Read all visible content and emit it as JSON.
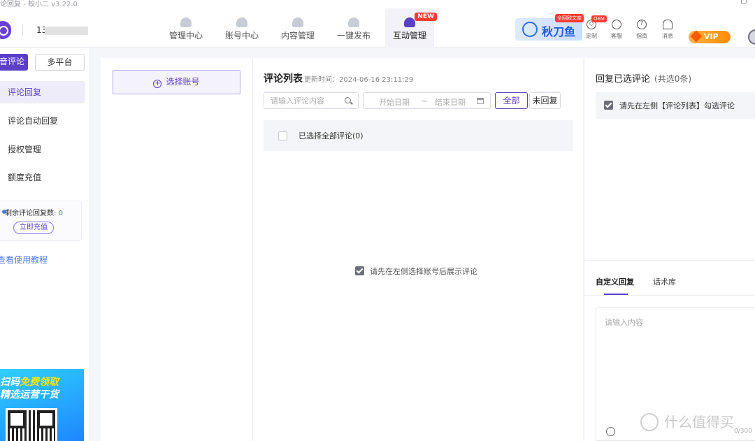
{
  "window": {
    "title": "论回复 - 蚁小二 v3.22.0"
  },
  "header": {
    "account_id": "13",
    "nav": [
      {
        "label": "管理中心",
        "icon": "dashboard-icon"
      },
      {
        "label": "账号中心",
        "icon": "user-icon"
      },
      {
        "label": "内容管理",
        "icon": "content-icon"
      },
      {
        "label": "一键发布",
        "icon": "publish-icon"
      },
      {
        "label": "互动管理",
        "icon": "robot-icon",
        "badge": "NEW",
        "active": true
      }
    ],
    "brand": {
      "name": "秋刀鱼",
      "badge": "全网欧文库"
    },
    "tools": [
      {
        "label": "定制",
        "icon": "diamond-icon",
        "badge": "OEM"
      },
      {
        "label": "客服",
        "icon": "headset-icon"
      },
      {
        "label": "指南",
        "icon": "help-icon"
      },
      {
        "label": "消息",
        "icon": "bell-icon"
      }
    ],
    "vip_label": "VIP"
  },
  "sidebar": {
    "tabs": [
      {
        "label": "音评论",
        "active": true
      },
      {
        "label": "多平台",
        "active": false
      }
    ],
    "menu": [
      {
        "label": "评论回复",
        "active": true
      },
      {
        "label": "评论自动回复"
      },
      {
        "label": "授权管理"
      },
      {
        "label": "额度充值"
      }
    ],
    "quota": {
      "label": "剩余评论回复数:",
      "value": "0",
      "button": "立即充值"
    },
    "tutorial_link": "查看使用教程",
    "promo": {
      "line1_prefix": "扫码",
      "line1_highlight": "免费领取",
      "line2": "精选运营干货"
    }
  },
  "account_panel": {
    "select_button": "选择账号",
    "plus_glyph": "+"
  },
  "comment_list": {
    "title": "评论列表",
    "updated_at": "更新时间：2024-06-16 23:11:29",
    "search_placeholder": "请输入评论内容",
    "date_start": "开始日期",
    "date_sep": "~",
    "date_end": "结束日期",
    "filters": [
      {
        "label": "全部",
        "active": true
      },
      {
        "label": "未回复",
        "active": false
      }
    ],
    "select_all_label": "已选择全部评论(0)",
    "empty_hint": "请先在左侧选择账号后展示评论"
  },
  "reply_panel": {
    "title": "回复已选评论",
    "count_text": "(共选0条)",
    "hint": "请先在左侧【评论列表】勾选评论",
    "tabs": [
      {
        "label": "自定义回复",
        "active": true
      },
      {
        "label": "话术库",
        "active": false
      }
    ],
    "input_placeholder": "请输入内容",
    "char_count": "0/300"
  },
  "watermark": "什么值得买",
  "colors": {
    "accent": "#5b3fc8",
    "link": "#4a7be8",
    "badge": "#ff3b30",
    "vip": "#ff8a00"
  }
}
